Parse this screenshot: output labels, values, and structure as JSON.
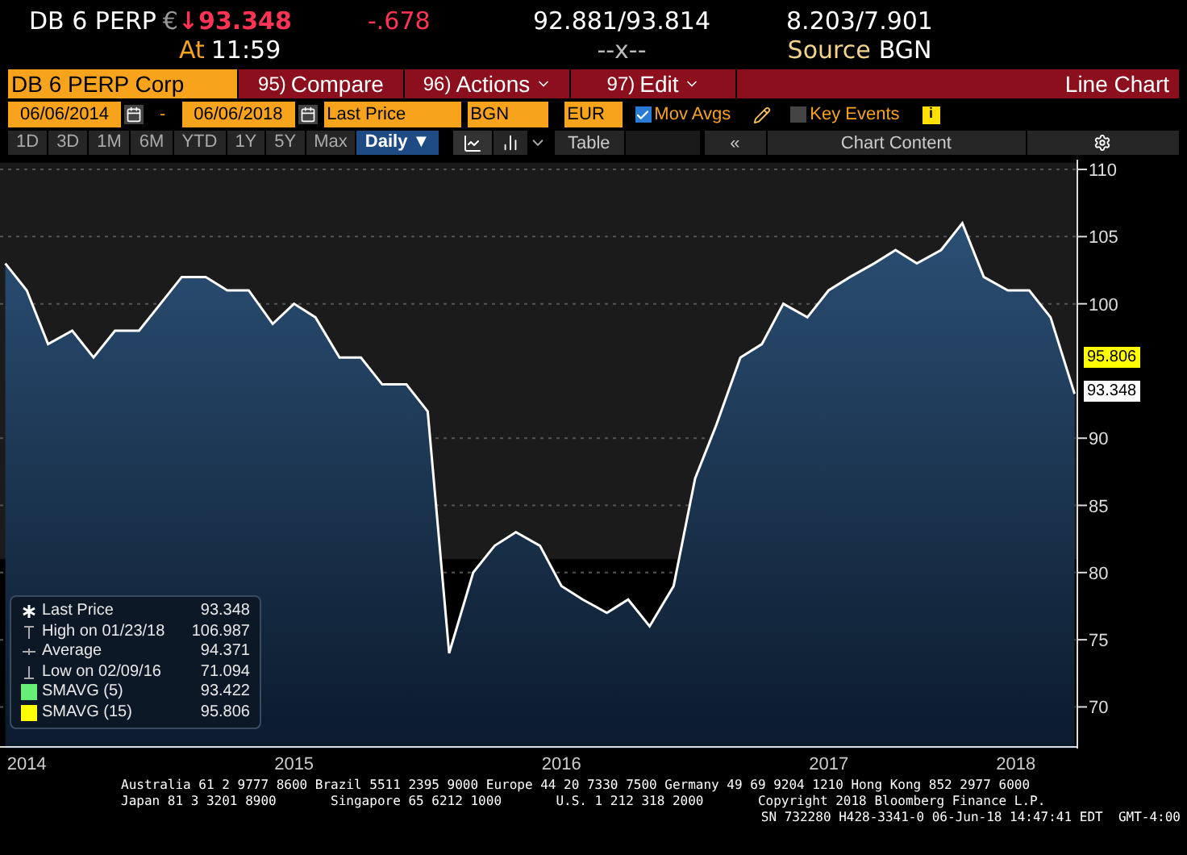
{
  "header": {
    "ticker": "DB 6 PERP",
    "currency": "€",
    "arrow": "↓",
    "price": "93.348",
    "change": "-.678",
    "bid": "92.881",
    "slash": "/",
    "ask": "93.814",
    "yield_bid": "8.203",
    "yield_ask": "7.901",
    "time_label": "At",
    "time": "11:59",
    "size": "--x--",
    "source_label": "Source",
    "source": "BGN"
  },
  "toolbar": {
    "security": "DB 6 PERP Corp",
    "buttons": [
      {
        "number": "95)",
        "label": "Compare",
        "menu": false
      },
      {
        "number": "96)",
        "label": "Actions",
        "menu": true
      },
      {
        "number": "97)",
        "label": "Edit",
        "menu": true
      }
    ],
    "title": "Line Chart"
  },
  "controls": {
    "start_date": "06/06/2014",
    "end_date": "06/06/2018",
    "separator": "-",
    "field": "Last Price",
    "source": "BGN",
    "currency": "EUR",
    "mov_avgs": {
      "label": "Mov Avgs",
      "checked": true
    },
    "key_events": {
      "label": "Key Events",
      "checked": false
    },
    "info": "i"
  },
  "periods": [
    {
      "label": "1D",
      "selected": false
    },
    {
      "label": "3D",
      "selected": false
    },
    {
      "label": "1M",
      "selected": false
    },
    {
      "label": "6M",
      "selected": false
    },
    {
      "label": "YTD",
      "selected": false
    },
    {
      "label": "1Y",
      "selected": false
    },
    {
      "label": "5Y",
      "selected": false
    },
    {
      "label": "Max",
      "selected": false
    },
    {
      "label": "Daily ▼",
      "selected": true
    }
  ],
  "view": {
    "table": "Table",
    "collapse": "«",
    "chart_content": "Chart Content"
  },
  "legend": [
    {
      "kind": "last",
      "value": "93.348"
    },
    {
      "kind": "high",
      "label": "High on 01/23/18",
      "value": "106.987"
    },
    {
      "kind": "average",
      "label": "Average",
      "value": "94.371"
    },
    {
      "kind": "low",
      "label": "Low on 02/09/16",
      "value": "71.094"
    },
    {
      "kind": "sma",
      "label": "SMAVG (5)",
      "value": "93.422",
      "color": "#66ee77"
    },
    {
      "kind": "sma",
      "label": "SMAVG (15)",
      "value": "95.806",
      "color": "#ffff00"
    }
  ],
  "price_tags": [
    {
      "label": "95.806",
      "color": "#ffff00"
    },
    {
      "label": "93.348",
      "color": "#ffffff"
    }
  ],
  "chart_data": {
    "type": "area",
    "x": [
      2014.42,
      2014.5,
      2014.58,
      2014.67,
      2014.75,
      2014.83,
      2014.92,
      2015.0,
      2015.08,
      2015.17,
      2015.25,
      2015.33,
      2015.42,
      2015.5,
      2015.58,
      2015.67,
      2015.75,
      2015.83,
      2015.92,
      2016.0,
      2016.08,
      2016.17,
      2016.25,
      2016.33,
      2016.42,
      2016.5,
      2016.58,
      2016.67,
      2016.75,
      2016.83,
      2016.92,
      2017.0,
      2017.08,
      2017.17,
      2017.25,
      2017.33,
      2017.42,
      2017.5,
      2017.58,
      2017.67,
      2017.75,
      2017.83,
      2017.92,
      2018.0,
      2018.08,
      2018.17,
      2018.25,
      2018.33,
      2018.42
    ],
    "series": [
      {
        "name": "Last Price",
        "color": "#ffffff",
        "values": [
          103,
          101,
          97,
          98,
          96,
          98,
          98,
          100,
          102,
          102,
          101,
          101,
          98.5,
          100,
          99,
          96,
          96,
          94,
          94,
          92,
          74,
          80,
          82,
          83,
          82,
          79,
          78,
          77,
          78,
          76,
          79,
          87,
          91,
          96,
          97,
          100,
          99,
          101,
          102,
          103,
          104,
          103,
          104,
          106,
          102,
          101,
          101,
          99,
          93.3
        ]
      }
    ],
    "xlim": [
      2014.4,
      2018.43
    ],
    "grid": true,
    "bands": [
      {
        "axis": "y",
        "from": 81,
        "to": 110.5,
        "color": "#1b1b1b"
      }
    ],
    "xticks": [
      {
        "value": 2014.5,
        "label": "2014"
      },
      {
        "value": 2015.5,
        "label": "2015"
      },
      {
        "value": 2016.5,
        "label": "2016"
      },
      {
        "value": 2017.5,
        "label": "2017"
      },
      {
        "value": 2018.2,
        "label": "2018"
      }
    ],
    "yticks": [
      {
        "value": 70,
        "label": "70"
      },
      {
        "value": 75,
        "label": "75"
      },
      {
        "value": 80,
        "label": "80"
      },
      {
        "value": 85,
        "label": "85"
      },
      {
        "value": 90,
        "label": "90"
      },
      {
        "value": 100,
        "label": "100"
      },
      {
        "value": 105,
        "label": "105"
      },
      {
        "value": 110,
        "label": "110"
      }
    ],
    "ylim": [
      67,
      111
    ]
  },
  "footer": [
    "Australia 61 2 9777 8600 Brazil 5511 2395 9000 Europe 44 20 7330 7500 Germany 49 69 9204 1210 Hong Kong 852 2977 6000",
    "Japan 81 3 3201 8900       Singapore 65 6212 1000       U.S. 1 212 318 2000       Copyright 2018 Bloomberg Finance L.P.",
    "SN 732280 H428-3341-0 06-Jun-18 14:47:41 EDT  GMT-4:00"
  ]
}
